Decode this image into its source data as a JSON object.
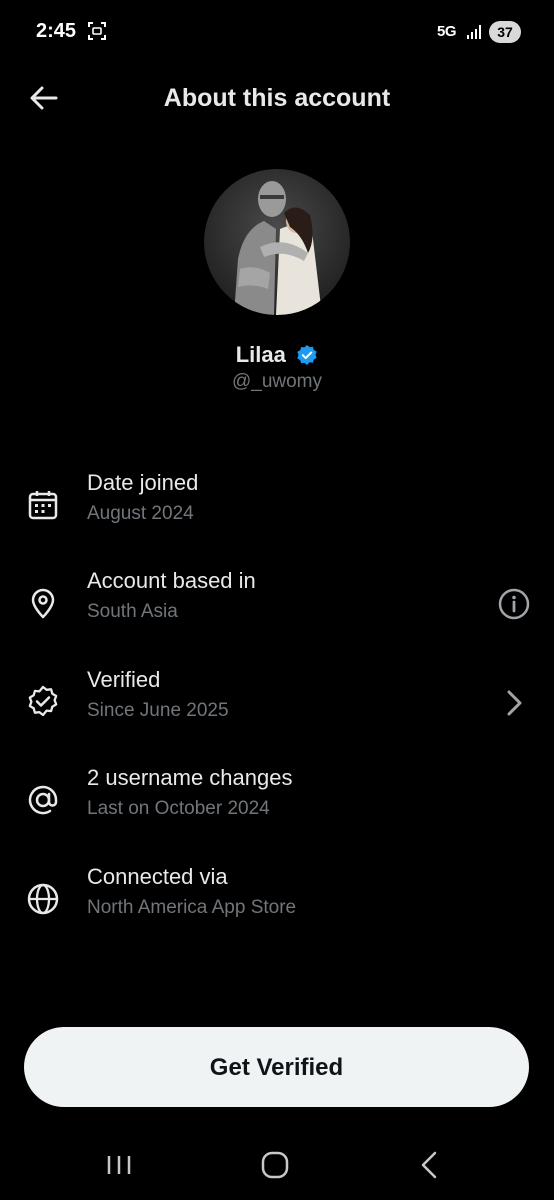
{
  "status_bar": {
    "time": "2:45",
    "network": "5G",
    "battery": "37"
  },
  "header": {
    "title": "About this account"
  },
  "profile": {
    "name": "Lilaa",
    "handle": "@_uwomy",
    "verified_color": "#1d9bf0"
  },
  "rows": [
    {
      "label": "Date joined",
      "sub": "August 2024",
      "icon": "calendar-icon"
    },
    {
      "label": "Account based in",
      "sub": "South Asia",
      "icon": "location-pin-icon",
      "trailing": "info-icon"
    },
    {
      "label": "Verified",
      "sub": "Since June 2025",
      "icon": "verified-check-icon",
      "trailing": "chevron-right-icon"
    },
    {
      "label": "2 username changes",
      "sub": "Last on October 2024",
      "icon": "at-sign-icon"
    },
    {
      "label": "Connected via",
      "sub": "North America App Store",
      "icon": "globe-icon"
    }
  ],
  "cta": {
    "label": "Get Verified"
  },
  "colors": {
    "background": "#000000",
    "primary_text": "#e7e9ea",
    "secondary_text": "#71767b",
    "button_bg": "#eff3f4"
  }
}
